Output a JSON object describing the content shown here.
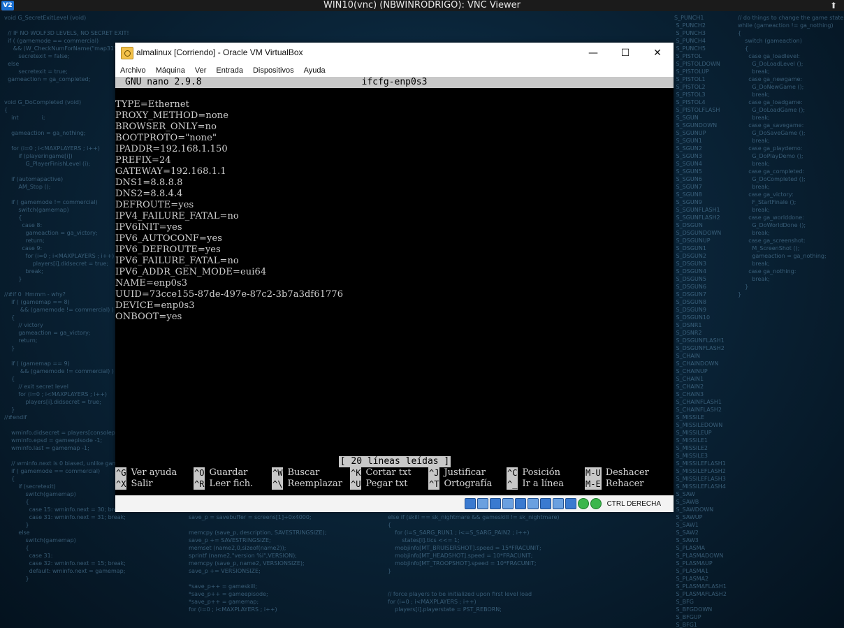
{
  "vnc": {
    "title": "WIN10(vnc) (NBWINRODRIGO): VNC Viewer",
    "logo": "V2",
    "collapse_glyph": "⬆"
  },
  "vbox": {
    "title": "almalinux [Corriendo] - Oracle VM VirtualBox",
    "minimize": "—",
    "maximize": "☐",
    "close": "✕",
    "menu": [
      "Archivo",
      "Máquina",
      "Ver",
      "Entrada",
      "Dispositivos",
      "Ayuda"
    ],
    "host_key": "CTRL DERECHA"
  },
  "nano": {
    "version": "GNU nano 2.9.8",
    "filename": "ifcfg-enp0s3",
    "lines": [
      "TYPE=Ethernet",
      "PROXY_METHOD=none",
      "BROWSER_ONLY=no",
      "BOOTPROTO=\"none\"",
      "IPADDR=192.168.1.150",
      "PREFIX=24",
      "GATEWAY=192.168.1.1",
      "DNS1=8.8.8.8",
      "DNS2=8.8.4.4",
      "DEFROUTE=yes",
      "IPV4_FAILURE_FATAL=no",
      "IPV6INIT=yes",
      "IPV6_AUTOCONF=yes",
      "IPV6_DEFROUTE=yes",
      "IPV6_FAILURE_FATAL=no",
      "IPV6_ADDR_GEN_MODE=eui64",
      "NAME=enp0s3",
      "UUID=73cce155-87de-497e-87c2-3b7a3df61776",
      "DEVICE=enp0s3",
      "ONBOOT=yes"
    ],
    "status": "[ 20 líneas leídas ]",
    "shortcuts_row1": [
      {
        "key": "^G",
        "label": "Ver ayuda"
      },
      {
        "key": "^O",
        "label": "Guardar"
      },
      {
        "key": "^W",
        "label": "Buscar"
      },
      {
        "key": "^K",
        "label": "Cortar txt"
      },
      {
        "key": "^J",
        "label": "Justificar"
      },
      {
        "key": "^C",
        "label": "Posición"
      },
      {
        "key": "M-U",
        "label": "Deshacer"
      }
    ],
    "shortcuts_row2": [
      {
        "key": "^X",
        "label": "Salir"
      },
      {
        "key": "^R",
        "label": "Leer fich."
      },
      {
        "key": "^\\",
        "label": "Reemplazar"
      },
      {
        "key": "^U",
        "label": "Pegar txt"
      },
      {
        "key": "^T",
        "label": "Ortografía"
      },
      {
        "key": "^_",
        "label": "Ir a línea"
      },
      {
        "key": "M-E",
        "label": "Rehacer"
      }
    ]
  }
}
